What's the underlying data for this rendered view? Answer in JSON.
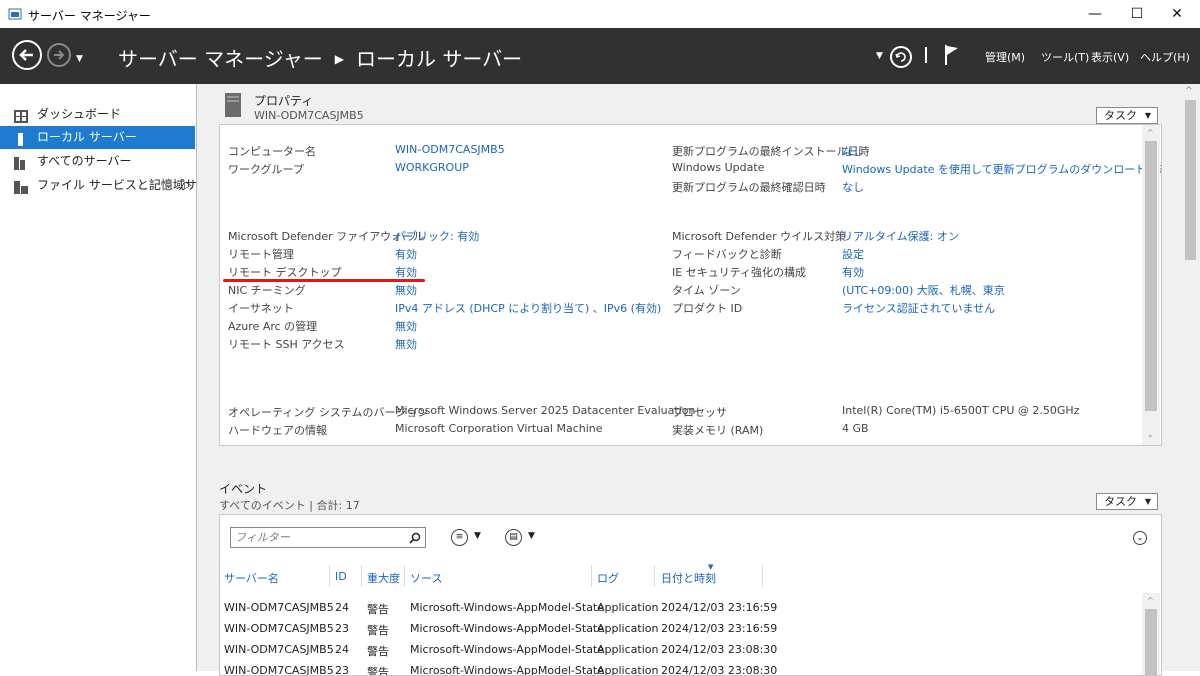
{
  "window": {
    "title": "サーバー マネージャー"
  },
  "header": {
    "breadcrumb_root": "サーバー マネージャー",
    "breadcrumb_current": "ローカル サーバー",
    "menus": [
      "管理(M)",
      "ツール(T)",
      "表示(V)",
      "ヘルプ(H)"
    ]
  },
  "sidebar": {
    "items": [
      {
        "label": "ダッシュボード",
        "icon": "dashboard-icon"
      },
      {
        "label": "ローカル サーバー",
        "icon": "local-server-icon"
      },
      {
        "label": "すべてのサーバー",
        "icon": "all-servers-icon"
      },
      {
        "label": "ファイル サービスと記憶域サ...",
        "icon": "file-services-icon"
      }
    ],
    "active_index": 1
  },
  "properties": {
    "title": "プロパティ",
    "subtitle": "WIN-ODM7CASJMB5",
    "task_label": "タスク",
    "left": [
      {
        "label": "コンピューター名",
        "value": "WIN-ODM7CASJMB5"
      },
      {
        "label": "ワークグループ",
        "value": "WORKGROUP"
      },
      {
        "label": "Microsoft Defender ファイアウォール",
        "value": "パブリック: 有効"
      },
      {
        "label": "リモート管理",
        "value": "有効"
      },
      {
        "label": "リモート デスクトップ",
        "value": "有効"
      },
      {
        "label": "NIC チーミング",
        "value": "無効"
      },
      {
        "label": "イーサネット",
        "value": "IPv4 アドレス (DHCP により割り当て) 、IPv6 (有効)"
      },
      {
        "label": "Azure Arc の管理",
        "value": "無効"
      },
      {
        "label": "リモート SSH アクセス",
        "value": "無効"
      }
    ],
    "right": [
      {
        "label": "更新プログラムの最終インストール日時",
        "value": "なし"
      },
      {
        "label": "Windows Update",
        "value": "Windows Update を使用して更新プログラムのダウンロードのみを行う"
      },
      {
        "label": "更新プログラムの最終確認日時",
        "value": "なし"
      },
      {
        "label": "Microsoft Defender ウイルス対策",
        "value": "リアルタイム保護: オン"
      },
      {
        "label": "フィードバックと診断",
        "value": "設定"
      },
      {
        "label": "IE セキュリティ強化の構成",
        "value": "有効"
      },
      {
        "label": "タイム ゾーン",
        "value": "(UTC+09:00) 大阪、札幌、東京"
      },
      {
        "label": "プロダクト ID",
        "value": "ライセンス認証されていません"
      }
    ],
    "hardware": [
      {
        "label": "オペレーティング システムのバージョン",
        "value": "Microsoft Windows Server 2025 Datacenter Evaluation"
      },
      {
        "label": "ハードウェアの情報",
        "value": "Microsoft Corporation Virtual Machine"
      },
      {
        "label": "プロセッサ",
        "value": "Intel(R) Core(TM) i5-6500T CPU @ 2.50GHz"
      },
      {
        "label": "実装メモリ (RAM)",
        "value": "4 GB"
      }
    ]
  },
  "events": {
    "title": "イベント",
    "subtitle": "すべてのイベント | 合計: 17",
    "task_label": "タスク",
    "filter_placeholder": "フィルター",
    "columns": [
      "サーバー名",
      "ID",
      "重大度",
      "ソース",
      "ログ",
      "日付と時刻"
    ],
    "rows": [
      [
        "WIN-ODM7CASJMB5",
        "24",
        "警告",
        "Microsoft-Windows-AppModel-State",
        "Application",
        "2024/12/03 23:16:59"
      ],
      [
        "WIN-ODM7CASJMB5",
        "23",
        "警告",
        "Microsoft-Windows-AppModel-State",
        "Application",
        "2024/12/03 23:16:59"
      ],
      [
        "WIN-ODM7CASJMB5",
        "24",
        "警告",
        "Microsoft-Windows-AppModel-State",
        "Application",
        "2024/12/03 23:08:30"
      ],
      [
        "WIN-ODM7CASJMB5",
        "23",
        "警告",
        "Microsoft-Windows-AppModel-State",
        "Application",
        "2024/12/03 23:08:30"
      ]
    ]
  },
  "colors": {
    "header_bg": "#313131",
    "accent": "#1e7bd0",
    "link": "#1a66b8",
    "highlight_underline": "#e8141a"
  }
}
